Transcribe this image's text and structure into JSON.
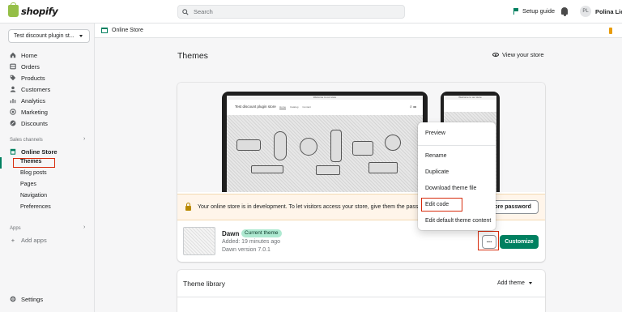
{
  "topbar": {
    "brand": "shopify",
    "search_placeholder": "Search",
    "setup_guide": "Setup guide",
    "avatar_initials": "PL",
    "user_name": "Polina Lioli"
  },
  "sidebar": {
    "store_name": "Test discount plugin st...",
    "items": [
      {
        "label": "Home",
        "icon": "home-icon"
      },
      {
        "label": "Orders",
        "icon": "orders-icon"
      },
      {
        "label": "Products",
        "icon": "tag-icon"
      },
      {
        "label": "Customers",
        "icon": "person-icon"
      },
      {
        "label": "Analytics",
        "icon": "bar-chart-icon"
      },
      {
        "label": "Marketing",
        "icon": "target-icon"
      },
      {
        "label": "Discounts",
        "icon": "discount-icon"
      }
    ],
    "sales_channels_label": "Sales channels",
    "online_store_label": "Online Store",
    "online_store_sub": [
      "Themes",
      "Blog posts",
      "Pages",
      "Navigation",
      "Preferences"
    ],
    "apps_label": "Apps",
    "add_apps": "Add apps",
    "settings": "Settings"
  },
  "breadcrumb": {
    "label": "Online Store"
  },
  "main": {
    "title": "Themes",
    "view_store": "View your store",
    "preview": {
      "desktop_bar": "Welcome to our store",
      "desktop_store": "Test discount plugin store",
      "desktop_nav": [
        "Home",
        "Catalog",
        "Contact"
      ],
      "mobile_bar": "Welcome to our store"
    },
    "banner_text": "Your online store is in development. To let visitors access your store, give them the passwo",
    "store_password_button": "tore password",
    "theme": {
      "name": "Dawn",
      "badge": "Current theme",
      "added": "Added: 19 minutes ago",
      "version": "Dawn version 7.0.1"
    },
    "more_button": "···",
    "customize_button": "Customize",
    "dropdown": [
      "Preview",
      "Rename",
      "Duplicate",
      "Download theme file",
      "Edit code",
      "Edit default theme content"
    ],
    "library_title": "Theme library",
    "add_theme": "Add theme"
  },
  "colors": {
    "accent": "#008060",
    "highlight": "#d72c0d",
    "badge": "#aee9d1",
    "banner_bg": "#fff5ea"
  }
}
